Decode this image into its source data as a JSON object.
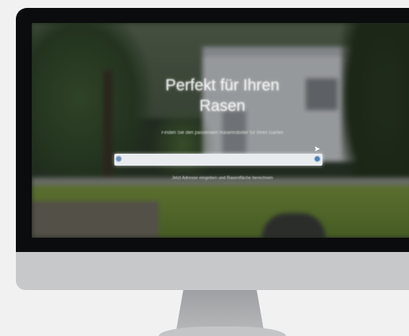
{
  "hero": {
    "title_line1": "Perfekt für Ihren",
    "title_line2": "Rasen",
    "subtitle": "Finden Sie den passenden Rasenroboter für Ihren Garten",
    "search_placeholder": "",
    "hint": "Jetzt Adresse eingeben und Rasenfläche berechnen"
  },
  "icons": {
    "pin": "location-pin-icon",
    "locate": "locate-icon",
    "pointer": "mouse-pointer-icon"
  },
  "colors": {
    "bezel": "#0b0c0d",
    "chin": "#c7c8ca",
    "background": "#f1f1f2",
    "search_field": "#e9ecef"
  }
}
